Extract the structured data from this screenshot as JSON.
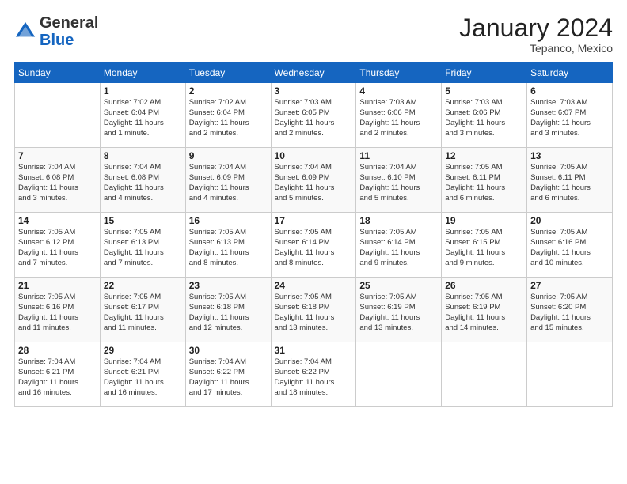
{
  "header": {
    "logo_general": "General",
    "logo_blue": "Blue",
    "month_title": "January 2024",
    "location": "Tepanco, Mexico"
  },
  "days_of_week": [
    "Sunday",
    "Monday",
    "Tuesday",
    "Wednesday",
    "Thursday",
    "Friday",
    "Saturday"
  ],
  "weeks": [
    [
      {
        "day": "",
        "info": ""
      },
      {
        "day": "1",
        "info": "Sunrise: 7:02 AM\nSunset: 6:04 PM\nDaylight: 11 hours\nand 1 minute."
      },
      {
        "day": "2",
        "info": "Sunrise: 7:02 AM\nSunset: 6:04 PM\nDaylight: 11 hours\nand 2 minutes."
      },
      {
        "day": "3",
        "info": "Sunrise: 7:03 AM\nSunset: 6:05 PM\nDaylight: 11 hours\nand 2 minutes."
      },
      {
        "day": "4",
        "info": "Sunrise: 7:03 AM\nSunset: 6:06 PM\nDaylight: 11 hours\nand 2 minutes."
      },
      {
        "day": "5",
        "info": "Sunrise: 7:03 AM\nSunset: 6:06 PM\nDaylight: 11 hours\nand 3 minutes."
      },
      {
        "day": "6",
        "info": "Sunrise: 7:03 AM\nSunset: 6:07 PM\nDaylight: 11 hours\nand 3 minutes."
      }
    ],
    [
      {
        "day": "7",
        "info": "Sunrise: 7:04 AM\nSunset: 6:08 PM\nDaylight: 11 hours\nand 3 minutes."
      },
      {
        "day": "8",
        "info": "Sunrise: 7:04 AM\nSunset: 6:08 PM\nDaylight: 11 hours\nand 4 minutes."
      },
      {
        "day": "9",
        "info": "Sunrise: 7:04 AM\nSunset: 6:09 PM\nDaylight: 11 hours\nand 4 minutes."
      },
      {
        "day": "10",
        "info": "Sunrise: 7:04 AM\nSunset: 6:09 PM\nDaylight: 11 hours\nand 5 minutes."
      },
      {
        "day": "11",
        "info": "Sunrise: 7:04 AM\nSunset: 6:10 PM\nDaylight: 11 hours\nand 5 minutes."
      },
      {
        "day": "12",
        "info": "Sunrise: 7:05 AM\nSunset: 6:11 PM\nDaylight: 11 hours\nand 6 minutes."
      },
      {
        "day": "13",
        "info": "Sunrise: 7:05 AM\nSunset: 6:11 PM\nDaylight: 11 hours\nand 6 minutes."
      }
    ],
    [
      {
        "day": "14",
        "info": "Sunrise: 7:05 AM\nSunset: 6:12 PM\nDaylight: 11 hours\nand 7 minutes."
      },
      {
        "day": "15",
        "info": "Sunrise: 7:05 AM\nSunset: 6:13 PM\nDaylight: 11 hours\nand 7 minutes."
      },
      {
        "day": "16",
        "info": "Sunrise: 7:05 AM\nSunset: 6:13 PM\nDaylight: 11 hours\nand 8 minutes."
      },
      {
        "day": "17",
        "info": "Sunrise: 7:05 AM\nSunset: 6:14 PM\nDaylight: 11 hours\nand 8 minutes."
      },
      {
        "day": "18",
        "info": "Sunrise: 7:05 AM\nSunset: 6:14 PM\nDaylight: 11 hours\nand 9 minutes."
      },
      {
        "day": "19",
        "info": "Sunrise: 7:05 AM\nSunset: 6:15 PM\nDaylight: 11 hours\nand 9 minutes."
      },
      {
        "day": "20",
        "info": "Sunrise: 7:05 AM\nSunset: 6:16 PM\nDaylight: 11 hours\nand 10 minutes."
      }
    ],
    [
      {
        "day": "21",
        "info": "Sunrise: 7:05 AM\nSunset: 6:16 PM\nDaylight: 11 hours\nand 11 minutes."
      },
      {
        "day": "22",
        "info": "Sunrise: 7:05 AM\nSunset: 6:17 PM\nDaylight: 11 hours\nand 11 minutes."
      },
      {
        "day": "23",
        "info": "Sunrise: 7:05 AM\nSunset: 6:18 PM\nDaylight: 11 hours\nand 12 minutes."
      },
      {
        "day": "24",
        "info": "Sunrise: 7:05 AM\nSunset: 6:18 PM\nDaylight: 11 hours\nand 13 minutes."
      },
      {
        "day": "25",
        "info": "Sunrise: 7:05 AM\nSunset: 6:19 PM\nDaylight: 11 hours\nand 13 minutes."
      },
      {
        "day": "26",
        "info": "Sunrise: 7:05 AM\nSunset: 6:19 PM\nDaylight: 11 hours\nand 14 minutes."
      },
      {
        "day": "27",
        "info": "Sunrise: 7:05 AM\nSunset: 6:20 PM\nDaylight: 11 hours\nand 15 minutes."
      }
    ],
    [
      {
        "day": "28",
        "info": "Sunrise: 7:04 AM\nSunset: 6:21 PM\nDaylight: 11 hours\nand 16 minutes."
      },
      {
        "day": "29",
        "info": "Sunrise: 7:04 AM\nSunset: 6:21 PM\nDaylight: 11 hours\nand 16 minutes."
      },
      {
        "day": "30",
        "info": "Sunrise: 7:04 AM\nSunset: 6:22 PM\nDaylight: 11 hours\nand 17 minutes."
      },
      {
        "day": "31",
        "info": "Sunrise: 7:04 AM\nSunset: 6:22 PM\nDaylight: 11 hours\nand 18 minutes."
      },
      {
        "day": "",
        "info": ""
      },
      {
        "day": "",
        "info": ""
      },
      {
        "day": "",
        "info": ""
      }
    ]
  ]
}
